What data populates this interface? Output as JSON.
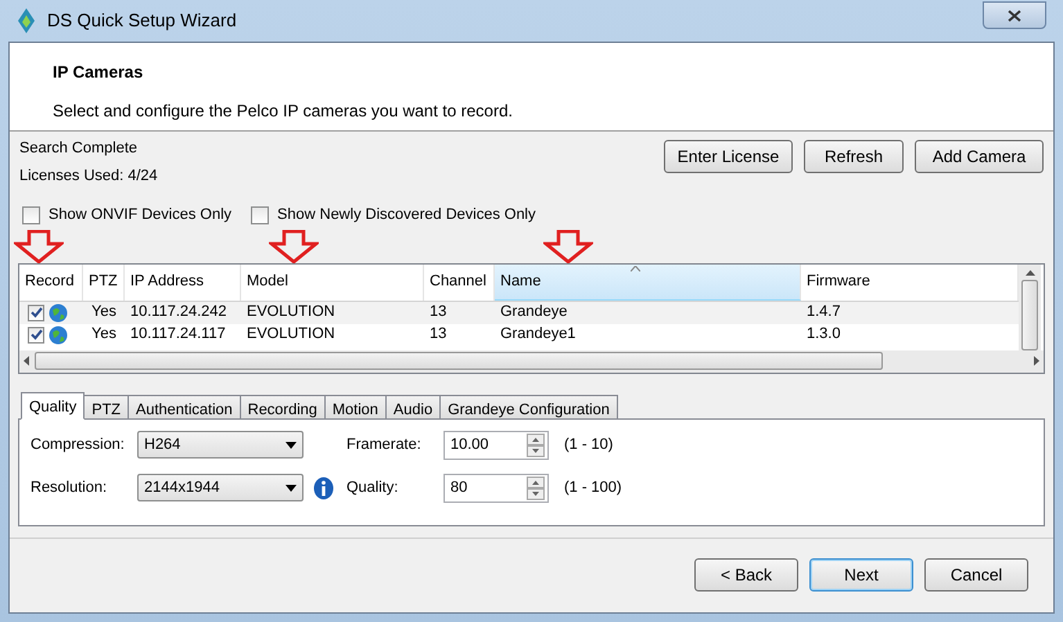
{
  "window": {
    "title": "DS Quick Setup Wizard"
  },
  "header": {
    "title": "IP Cameras",
    "subtitle": "Select and configure the Pelco IP cameras you want to record."
  },
  "status": [
    "Search Complete",
    "Licenses Used: 4/24"
  ],
  "top_buttons": [
    "Enter License",
    "Refresh",
    "Add Camera"
  ],
  "filters": [
    {
      "label": "Show ONVIF Devices Only",
      "checked": false
    },
    {
      "label": "Show Newly Discovered Devices Only",
      "checked": false
    }
  ],
  "table": {
    "columns": [
      {
        "label": "Record",
        "sorted": false
      },
      {
        "label": "PTZ",
        "sorted": false
      },
      {
        "label": "IP Address",
        "sorted": false
      },
      {
        "label": "Model",
        "sorted": false
      },
      {
        "label": "Channel",
        "sorted": false
      },
      {
        "label": "Name",
        "sorted": true
      },
      {
        "label": "Firmware",
        "sorted": false
      }
    ],
    "rows": [
      {
        "record": true,
        "ptz": "Yes",
        "ip": "10.117.24.242",
        "model": "EVOLUTION",
        "channel": "13",
        "name": "Grandeye",
        "firmware": "1.4.7"
      },
      {
        "record": true,
        "ptz": "Yes",
        "ip": "10.117.24.117",
        "model": "EVOLUTION",
        "channel": "13",
        "name": "Grandeye1",
        "firmware": "1.3.0"
      }
    ]
  },
  "tabs": [
    {
      "label": "Quality",
      "selected": true
    },
    {
      "label": "PTZ",
      "selected": false
    },
    {
      "label": "Authentication",
      "selected": false
    },
    {
      "label": "Recording",
      "selected": false
    },
    {
      "label": "Motion",
      "selected": false
    },
    {
      "label": "Audio",
      "selected": false
    },
    {
      "label": "Grandeye Configuration",
      "selected": false
    }
  ],
  "quality": {
    "compression": {
      "label": "Compression:",
      "value": "H264"
    },
    "resolution": {
      "label": "Resolution:",
      "value": "2144x1944"
    },
    "framerate": {
      "label": "Framerate:",
      "value": "10.00",
      "range": "(1 - 10)"
    },
    "quality": {
      "label": "Quality:",
      "value": "80",
      "range": "(1 - 100)"
    }
  },
  "footer_buttons": [
    {
      "label": "< Back",
      "default": false
    },
    {
      "label": "Next",
      "default": true
    },
    {
      "label": "Cancel",
      "default": false
    }
  ]
}
